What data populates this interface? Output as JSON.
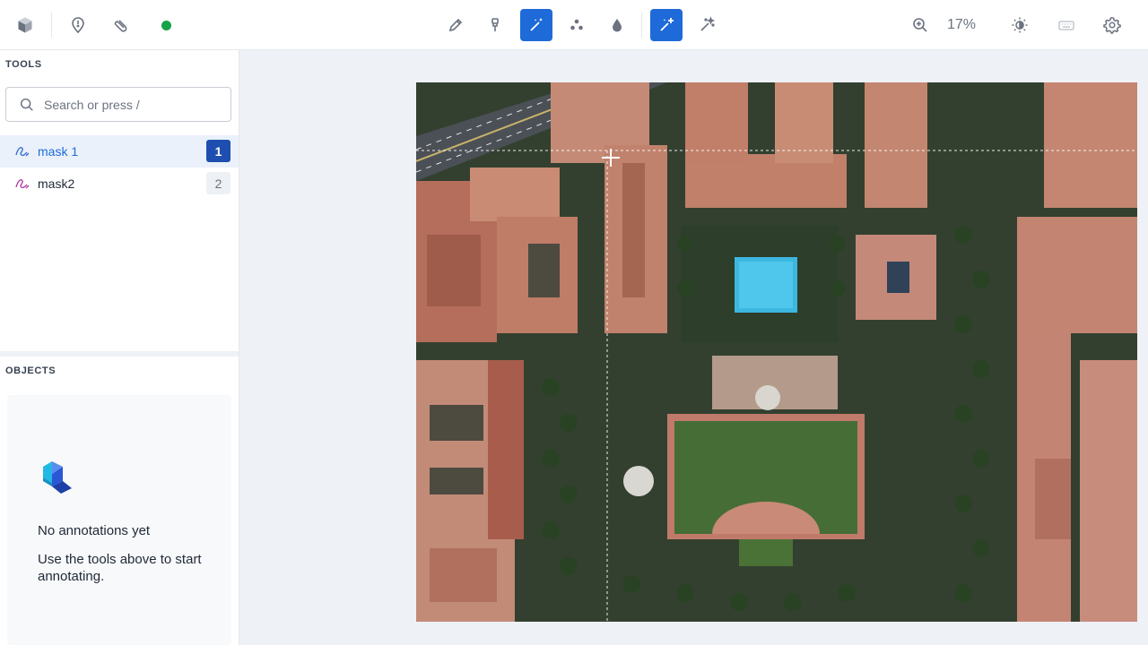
{
  "toolbar": {
    "left_icons": [
      "cube-icon",
      "map-pin-icon",
      "paperclip-icon"
    ],
    "status_color": "#16a34a",
    "center_tools": [
      {
        "name": "pencil-icon",
        "active": false
      },
      {
        "name": "brush-icon",
        "active": false
      },
      {
        "name": "magic-wand-icon",
        "active": true
      },
      {
        "name": "keypoints-icon",
        "active": false
      },
      {
        "name": "drop-icon",
        "active": false
      }
    ],
    "smart_tools": [
      {
        "name": "magic-wand-plus-icon",
        "active": true
      },
      {
        "name": "magic-wand-outline-icon",
        "active": false
      }
    ],
    "zoom_label": "17%",
    "right_icons": [
      "zoom-in-icon",
      "brightness-icon",
      "keyboard-icon",
      "settings-icon"
    ]
  },
  "sidebar": {
    "tools_title": "TOOLS",
    "search_placeholder": "Search or press /",
    "tools": [
      {
        "label": "mask 1",
        "key": "1",
        "selected": true,
        "color": "#3b6fd1"
      },
      {
        "label": "mask2",
        "key": "2",
        "selected": false,
        "color": "#b23fa3"
      }
    ],
    "objects_title": "OBJECTS",
    "empty_title": "No annotations yet",
    "empty_subtitle": "Use the tools above to start annotating."
  },
  "colors": {
    "accent": "#1e6ad8",
    "selected_bg": "#eaf1fb"
  }
}
